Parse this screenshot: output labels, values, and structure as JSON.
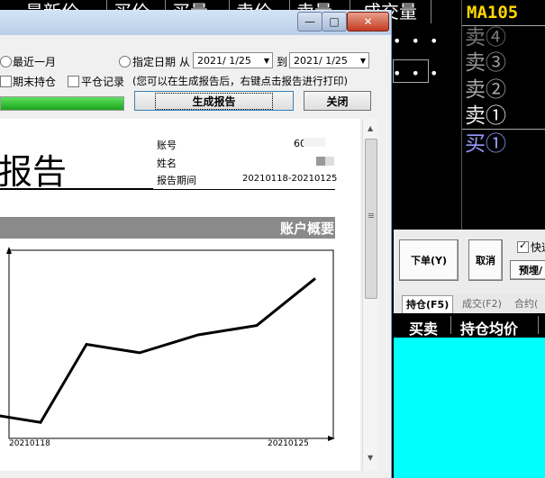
{
  "background": {
    "headers": [
      "最新价",
      "买价",
      "买量",
      "卖价",
      "卖量",
      "成交量"
    ],
    "quote": {
      "contract": "MA105",
      "levels": [
        "卖④",
        "卖③",
        "卖②",
        "卖①",
        "买①"
      ]
    },
    "controls": {
      "order_button": "下单(Y)",
      "cancel_button": "取消",
      "quick_checkbox": "快速",
      "preset_button": "预埋/"
    },
    "tabs": [
      "持仓(F5)",
      "成交(F2)",
      "合约("
    ],
    "table_columns": [
      "买卖",
      "持仓均价"
    ],
    "colors": {
      "quote_name": "#ffd800",
      "buy_level": "#9999ff",
      "positions_bg": "#00ffff"
    }
  },
  "dialog": {
    "title_buttons": {
      "minimize": "—",
      "maximize": "□",
      "close": "✕"
    },
    "options": {
      "recent_month": "最近一月",
      "specified_date": "指定日期",
      "from": "从",
      "to": "到",
      "date_from": "2021/ 1/25",
      "date_to": "2021/ 1/25",
      "period_end_position": "期末持仓",
      "close_record": "平仓记录",
      "hint": "(您可以在生成报告后，右键点击报告进行打印)"
    },
    "progress": 1.0,
    "generate_button": "生成报告",
    "close_button": "关闭"
  },
  "report": {
    "title": "报告",
    "account_label": "账号",
    "account_value": "60",
    "name_label": "姓名",
    "period_label": "报告期间",
    "period_value": "20210118-20210125",
    "section_title": "账户概要",
    "chart_data": {
      "type": "line",
      "x": [
        "",
        "20210118",
        "",
        "",
        "",
        "",
        "",
        "20210125"
      ],
      "series": [
        {
          "values": [
            0.27,
            0.17,
            1.0,
            0.91,
            1.1,
            1.2,
            1.7
          ]
        }
      ],
      "xlabels": [
        "20210118",
        "20210125"
      ],
      "grid": false
    }
  }
}
